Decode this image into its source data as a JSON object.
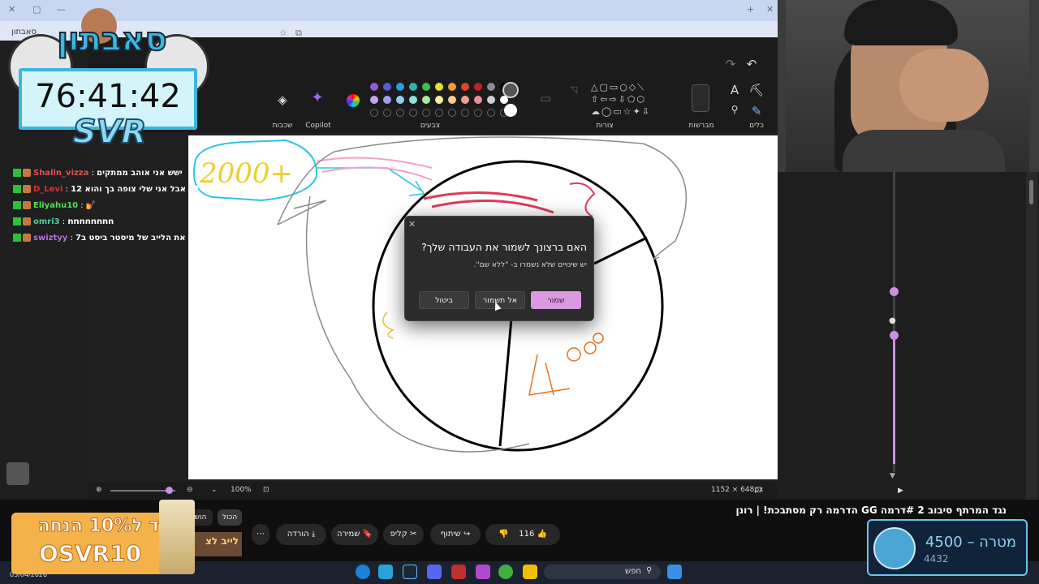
{
  "browser": {
    "tab_close": "✕",
    "addr_text": "סאבתון"
  },
  "paint": {
    "groups": {
      "layers": "שכבות",
      "copilot": "Copilot",
      "colors": "צבעים",
      "shapes": "צורות",
      "brushes": "מברשות",
      "tools": "כלים"
    },
    "palette_row1": [
      "#8e5cd9",
      "#5a5ad6",
      "#2f9be3",
      "#2fb3a8",
      "#3fbf4a",
      "#e8e02f",
      "#f29a2f",
      "#e0442f",
      "#c0202a",
      "#8a8a8a",
      "#000000"
    ],
    "palette_row2": [
      "#c8a2e8",
      "#a0a0f0",
      "#90ccf0",
      "#90e0d8",
      "#a8e8a0",
      "#f4f0a0",
      "#f6cc90",
      "#f0a090",
      "#e89090",
      "#cfcfcf",
      "#ffffff"
    ],
    "zoom": "100%",
    "canvas_size": "1152 × 648px",
    "dialog": {
      "title": "האם ברצונך לשמור את העבודה שלך?",
      "subtitle": "יש שינויים שלא נשמרו ב- \"ללא שם\".",
      "save": "שמור",
      "dont_save": "אל תשמור",
      "cancel": "ביטול",
      "close": "✕"
    }
  },
  "chat": {
    "messages": [
      {
        "user": "Shalin_vizza",
        "text": "ישש אני אוהב ממתקים",
        "color": "#e05050"
      },
      {
        "user": "D_Levi",
        "text": "וואלה אני 21 אבל אני שלי צופה בך והוא 12",
        "color": "#e03030"
      },
      {
        "user": "Eliyahu10",
        "text": "💅",
        "color": "#4fe04f"
      },
      {
        "user": "omri3",
        "text": "nnnnnnnn",
        "color": "#4fd0a0"
      },
      {
        "user": "swiztyy",
        "text": "אתה תראה את הלייב של מיסטר ביסט ב7?",
        "color": "#b070e0"
      }
    ]
  },
  "stream_overlay": {
    "logo": "סאבתון",
    "timer": "76:41:42",
    "svr": "SVR",
    "promo_line1": "קוד ל10% הנחה",
    "promo_line2": "OSVR10",
    "promo_small": "לייב לצ",
    "goal_label": "מטרה – 4500",
    "goal_current": "4432"
  },
  "youtube": {
    "title": "הדרמה רק מסתבכת! | רונן GG נגד המרתף סיבוב 2 #דרמה",
    "chips": [
      "הכול",
      "הוש"
    ],
    "likes": "116",
    "share": "שיתוף",
    "clip": "קליפ",
    "save": "שמירה",
    "download": "הורדה",
    "more": "⋯"
  },
  "taskbar": {
    "search": "חפש",
    "date": "05/04/2026"
  }
}
